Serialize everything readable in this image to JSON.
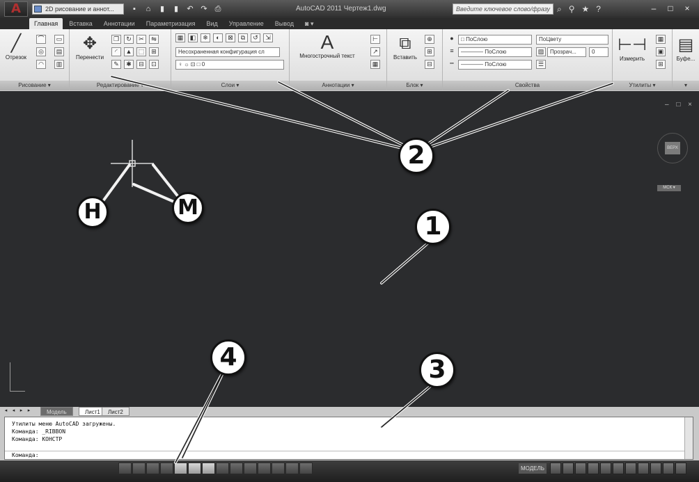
{
  "title_bar": {
    "logo": "A",
    "workspace": "2D рисование и аннот...",
    "qat_icons": [
      "new-icon",
      "open-icon",
      "save-icon",
      "save-as-icon",
      "undo-icon",
      "redo-icon",
      "plot-icon"
    ],
    "qat_glyphs": [
      "▪",
      "⌂",
      "▮",
      "▮",
      "↶",
      "↷",
      "⎙"
    ],
    "window_title": "AutoCAD 2011   Чертеж1.dwg",
    "search_placeholder": "Введите ключевое слово/фразу",
    "tools": [
      "⌕",
      "⚲",
      "★",
      "?"
    ],
    "window_buttons": [
      "–",
      "□",
      "×"
    ]
  },
  "tabs": [
    {
      "label": "Главная",
      "active": true
    },
    {
      "label": "Вставка"
    },
    {
      "label": "Аннотации"
    },
    {
      "label": "Параметризация"
    },
    {
      "label": "Вид"
    },
    {
      "label": "Управление"
    },
    {
      "label": "Вывод"
    },
    {
      "label": "◙ ▾"
    }
  ],
  "ribbon": {
    "draw": {
      "title": "Рисование ▾",
      "line_label": "Отрезок"
    },
    "modify": {
      "title": "Редактирование ▾",
      "move_label": "Перенести"
    },
    "layers": {
      "title": "Слои ▾",
      "layer_state": "Несохраненная конфигурация сл",
      "current_layer": "0"
    },
    "annotation": {
      "title": "Аннотации ▾",
      "mtext_label": "Многострочный текст",
      "mtext_glyph": "A"
    },
    "block": {
      "title": "Блок ▾",
      "insert_label": "Вставить"
    },
    "properties": {
      "title": "Свойства",
      "color": "ПоСлою",
      "plot_style": "ПоЦвету",
      "lineweight": "———— ПоСлою",
      "linetype": "———— ПоСлою",
      "transparency_label": "Прозрач...",
      "transparency_value": "0"
    },
    "utilities": {
      "title": "Утилиты ▾",
      "measure_label": "Измерить"
    },
    "clipboard": {
      "label": "Буфе..."
    }
  },
  "drawing": {
    "viewcube_face": "ВЕРХ",
    "viewport_label": "МСК ▾",
    "controls": "– □ ×"
  },
  "layout_tabs": {
    "nav": [
      "◂",
      "◂",
      "▸",
      "▸"
    ],
    "model": "Модель",
    "sheet1": "Лист1",
    "sheet2": "Лист2"
  },
  "command_line": {
    "history": [
      "Утилиты меню AutoCAD загружены.",
      "Команда: _RIBBON",
      "Команда: КОНСТР"
    ],
    "prompt": "Команда:"
  },
  "status_bar": {
    "coords": "",
    "model": "МОДЕЛЬ"
  },
  "callouts": [
    "1",
    "2",
    "3",
    "4",
    "H",
    "M"
  ]
}
